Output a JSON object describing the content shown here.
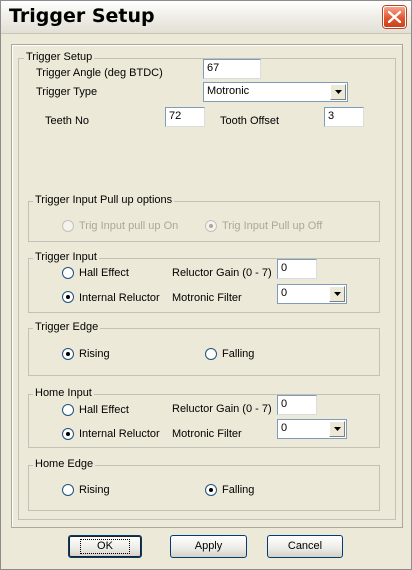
{
  "window": {
    "title": "Trigger Setup"
  },
  "trigger_setup": {
    "group_label": "Trigger Setup",
    "angle_label": "Trigger Angle (deg BTDC)",
    "angle_value": "67",
    "type_label": "Trigger Type",
    "type_value": "Motronic",
    "teeth_label": "Teeth No",
    "teeth_value": "72",
    "offset_label": "Tooth Offset",
    "offset_value": "3"
  },
  "pullup": {
    "group_label": "Trigger Input Pull up options",
    "on_label": "Trig Input pull up On",
    "off_label": "Trig Input Pull up Off",
    "selected": "off"
  },
  "trigger_input": {
    "group_label": "Trigger Input",
    "hall_label": "Hall Effect",
    "reluctor_label": "Internal Reluctor",
    "selected": "reluctor",
    "gain_label": "Reluctor Gain (0 - 7)",
    "gain_value": "0",
    "filter_label": "Motronic Filter",
    "filter_value": "0"
  },
  "trigger_edge": {
    "group_label": "Trigger Edge",
    "rising_label": "Rising",
    "falling_label": "Falling",
    "selected": "rising"
  },
  "home_input": {
    "group_label": "Home Input",
    "hall_label": "Hall Effect",
    "reluctor_label": "Internal Reluctor",
    "selected": "reluctor",
    "gain_label": "Reluctor Gain (0 - 7)",
    "gain_value": "0",
    "filter_label": "Motronic Filter",
    "filter_value": "0"
  },
  "home_edge": {
    "group_label": "Home Edge",
    "rising_label": "Rising",
    "falling_label": "Falling",
    "selected": "falling"
  },
  "buttons": {
    "ok": "OK",
    "apply": "Apply",
    "cancel": "Cancel"
  },
  "icons": {
    "close": "close-icon",
    "dropdown": "chevron-down-icon"
  },
  "colors": {
    "close_button": "#e2562f",
    "disabled_text": "#aca899",
    "face": "#ece9d8"
  }
}
